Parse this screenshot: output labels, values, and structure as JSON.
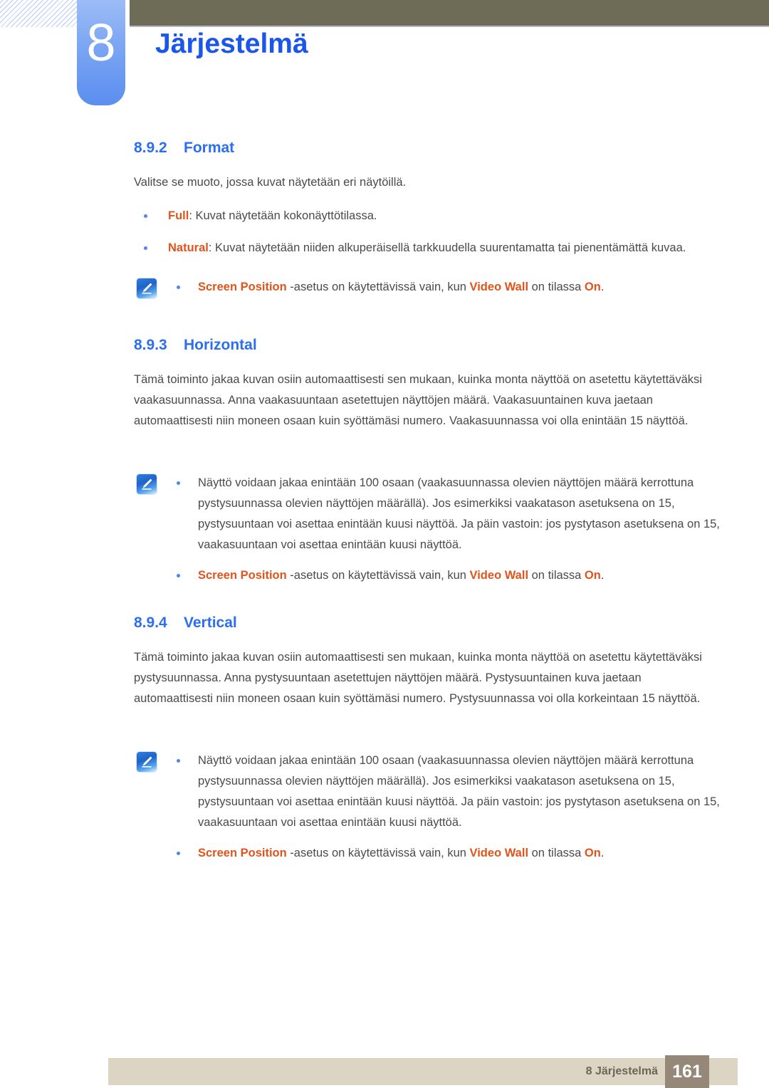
{
  "header": {
    "chapter_number": "8",
    "chapter_title": "Järjestelmä",
    "accent_blue": "#1a56e8",
    "bar_color": "#6e6b57",
    "badge_color": "#7ba5f3"
  },
  "sections": {
    "format": {
      "number": "8.9.2",
      "title": "Format",
      "intro": "Valitse se muoto, jossa kuvat näytetään eri näytöillä.",
      "bullets": [
        {
          "keyword": "Full",
          "rest": ": Kuvat näytetään kokonäyttötilassa."
        },
        {
          "keyword": "Natural",
          "rest": ": Kuvat näytetään niiden alkuperäisellä tarkkuudella suurentamatta tai pienentämättä kuvaa."
        }
      ],
      "note": {
        "icon": "pencil-note-icon",
        "kw1": "Screen Position",
        "mid1": " -asetus on käytettävissä vain, kun ",
        "kw2": "Video Wall",
        "mid2": " on tilassa ",
        "kw3": "On",
        "end": "."
      }
    },
    "horizontal": {
      "number": "8.9.3",
      "title": "Horizontal",
      "paragraph": "Tämä toiminto jakaa kuvan osiin automaattisesti sen mukaan, kuinka monta näyttöä on asetettu käytettäväksi vaakasuunnassa. Anna vaakasuuntaan asetettujen näyttöjen määrä. Vaakasuuntainen kuva jaetaan automaattisesti niin moneen osaan kuin syöttämäsi numero. Vaakasuunnassa voi olla enintään 15 näyttöä.",
      "note": {
        "icon": "pencil-note-icon",
        "text": "Näyttö voidaan jakaa enintään 100 osaan (vaakasuunnassa olevien näyttöjen määrä kerrottuna pystysuunnassa olevien näyttöjen määrällä). Jos esimerkiksi vaakatason asetuksena on 15, pystysuuntaan voi asettaa enintään kuusi näyttöä. Ja päin vastoin: jos pystytason asetuksena on 15, vaakasuuntaan voi asettaa enintään kuusi näyttöä.",
        "kw1": "Screen Position",
        "mid1": " -asetus on käytettävissä vain, kun ",
        "kw2": "Video Wall",
        "mid2": " on tilassa ",
        "kw3": "On",
        "end": "."
      }
    },
    "vertical": {
      "number": "8.9.4",
      "title": "Vertical",
      "paragraph": "Tämä toiminto jakaa kuvan osiin automaattisesti sen mukaan, kuinka monta näyttöä on asetettu käytettäväksi pystysuunnassa. Anna pystysuuntaan asetettujen näyttöjen määrä. Pystysuuntainen kuva jaetaan automaattisesti niin moneen osaan kuin syöttämäsi numero. Pystysuunnassa voi olla korkeintaan 15 näyttöä.",
      "note": {
        "icon": "pencil-note-icon",
        "text": "Näyttö voidaan jakaa enintään 100 osaan (vaakasuunnassa olevien näyttöjen määrä kerrottuna pystysuunnassa olevien näyttöjen määrällä). Jos esimerkiksi vaakatason asetuksena on 15, pystysuuntaan voi asettaa enintään kuusi näyttöä. Ja päin vastoin: jos pystytason asetuksena on 15, vaakasuuntaan voi asettaa enintään kuusi näyttöä.",
        "kw1": "Screen Position",
        "mid1": " -asetus on käytettävissä vain, kun ",
        "kw2": "Video Wall",
        "mid2": " on tilassa ",
        "kw3": "On",
        "end": "."
      }
    }
  },
  "footer": {
    "label": "8 Järjestelmä",
    "page_number": "161",
    "bar_color": "#dcd5c4",
    "page_box_color": "#968878"
  }
}
